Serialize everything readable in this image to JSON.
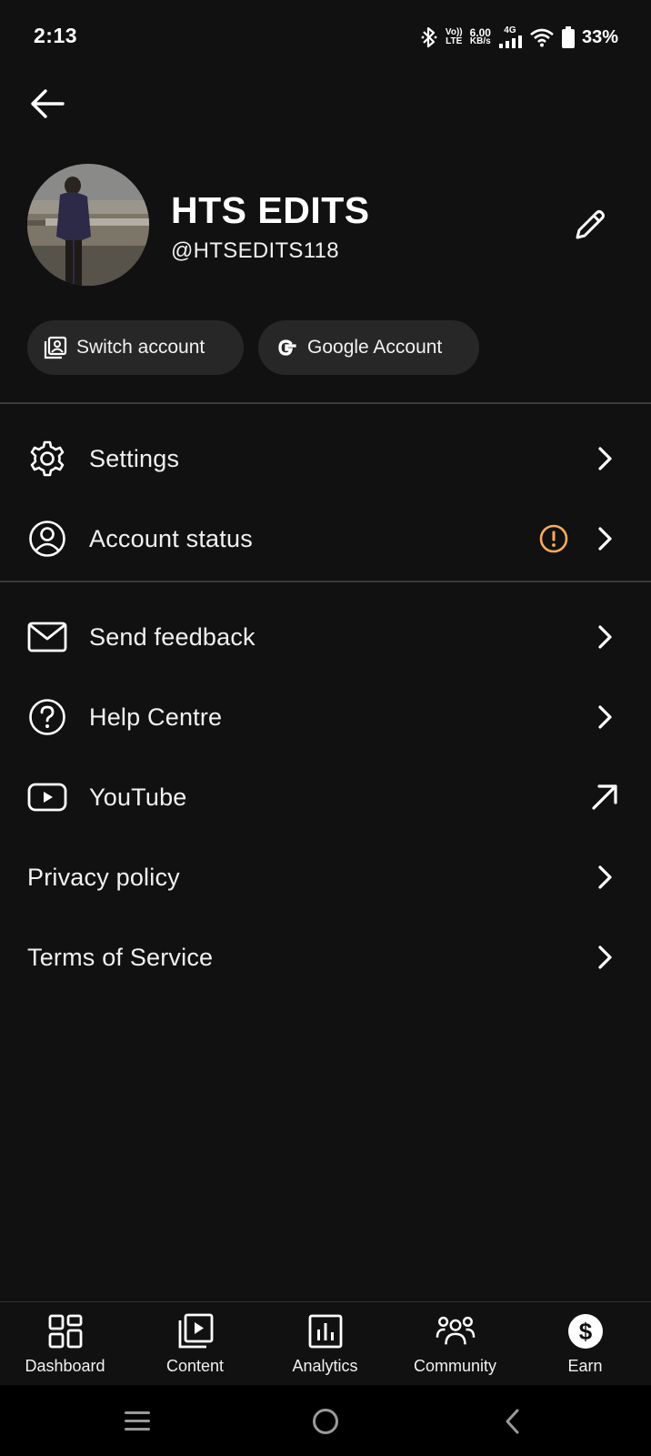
{
  "status_bar": {
    "time": "2:13",
    "volte_top": "Vo))",
    "volte_bottom": "LTE",
    "speed_value": "6.00",
    "speed_unit": "KB/s",
    "network": "4G",
    "battery": "33%"
  },
  "profile": {
    "name": "HTS EDITS",
    "handle": "@HTSEDITS118"
  },
  "chips": {
    "switch_account": "Switch account",
    "google_account": "Google Account"
  },
  "menu": {
    "settings": "Settings",
    "account_status": "Account status",
    "send_feedback": "Send feedback",
    "help_centre": "Help Centre",
    "youtube": "YouTube",
    "privacy_policy": "Privacy policy",
    "terms_of_service": "Terms of Service"
  },
  "bottom_nav": {
    "dashboard": "Dashboard",
    "content": "Content",
    "analytics": "Analytics",
    "community": "Community",
    "earn": "Earn"
  },
  "colors": {
    "background": "#111111",
    "chip_background": "#272727",
    "warning_accent": "#f9ab5c",
    "divider": "#3a3a3a"
  },
  "icons": {
    "back": "arrow-left-icon",
    "edit": "pencil-icon",
    "settings": "gear-icon",
    "account_status": "account-circle-icon",
    "warning": "exclamation-circle-icon",
    "send_feedback": "envelope-icon",
    "help_centre": "question-circle-icon",
    "youtube": "youtube-play-icon",
    "external": "arrow-up-right-icon"
  }
}
